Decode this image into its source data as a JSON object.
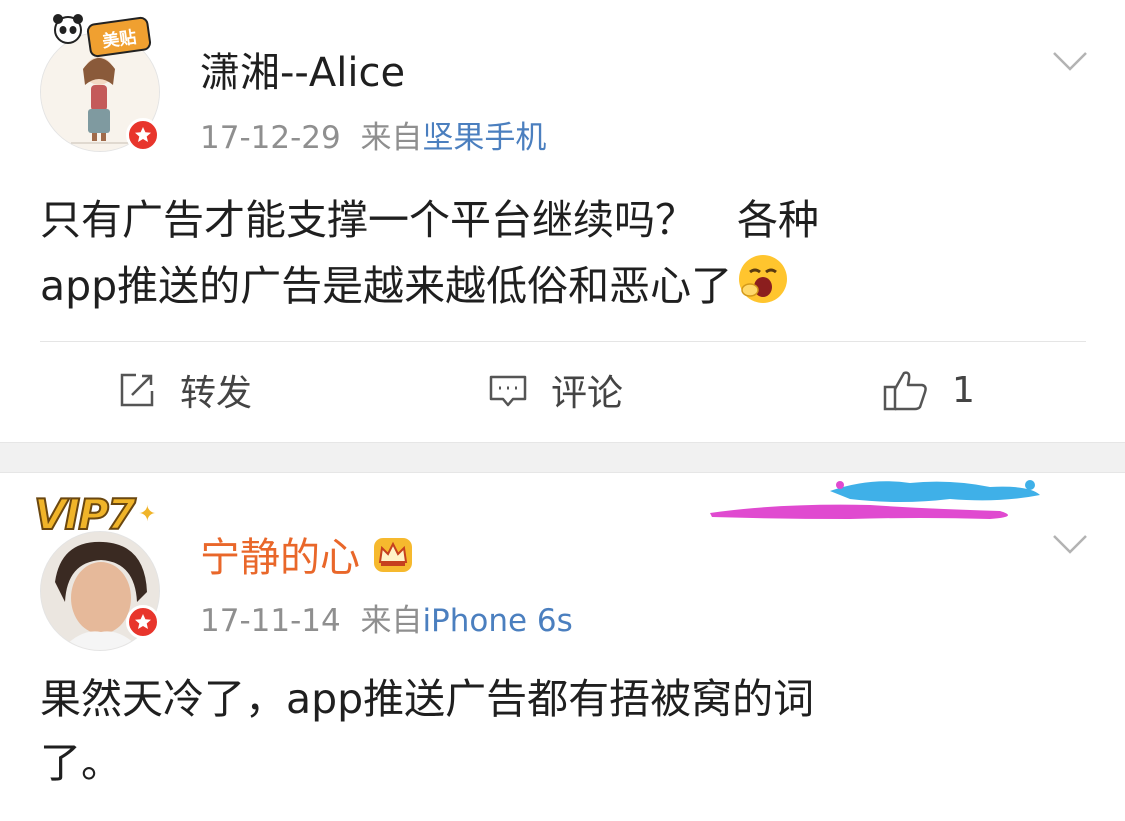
{
  "posts": [
    {
      "user_name": "潇湘--Alice",
      "date": "17-12-29",
      "source_prefix": "来自",
      "source": "坚果手机",
      "avatar_badge": "美贴",
      "text_lines": [
        "只有广告才能支撑一个平台继续吗？　各种",
        "app推送的广告是越来越低俗和恶心了"
      ],
      "emoji": "yawn-emoji",
      "actions": {
        "repost_label": "转发",
        "comment_label": "评论",
        "like_count": "1"
      }
    },
    {
      "user_name": "宁静的心",
      "date": "17-11-14",
      "source_prefix": "来自",
      "source": "iPhone 6s",
      "vip_badge": "VIP7",
      "name_color": "#e9672a",
      "text_lines": [
        "果然天冷了，app推送广告都有捂被窝的词",
        "了。"
      ]
    }
  ],
  "colors": {
    "source_link": "#4b7fbf",
    "meta_gray": "#8f8f8f",
    "verified_red": "#e8352c",
    "separator": "#f1f1f1"
  },
  "icons": [
    "chevron-down-icon",
    "verified-icon",
    "repost-icon",
    "comment-icon",
    "like-icon",
    "crown-icon"
  ]
}
